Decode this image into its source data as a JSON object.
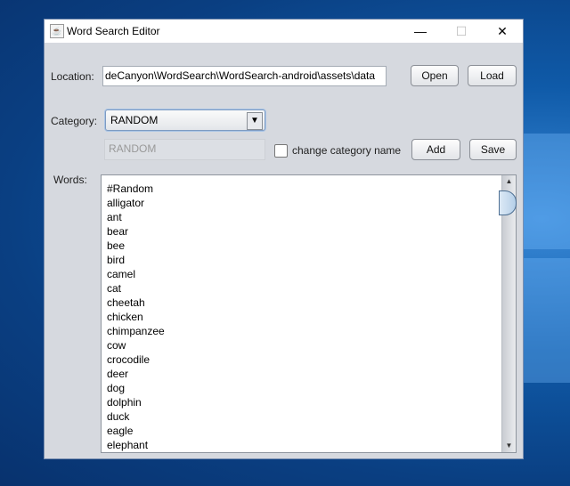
{
  "window": {
    "title": "Word Search Editor",
    "minimize": "—",
    "maximize": "☐",
    "close": "✕"
  },
  "location": {
    "label": "Location:",
    "value": "deCanyon\\WordSearch\\WordSearch-android\\assets\\data",
    "open": "Open",
    "load": "Load"
  },
  "category": {
    "label": "Category:",
    "selected": "RANDOM",
    "name_value": "RANDOM",
    "change_label": "change category name",
    "add": "Add",
    "save": "Save"
  },
  "words": {
    "label": "Words:",
    "items": [
      "#Random",
      "alligator",
      "ant",
      "bear",
      "bee",
      "bird",
      "camel",
      "cat",
      "cheetah",
      "chicken",
      "chimpanzee",
      "cow",
      "crocodile",
      "deer",
      "dog",
      "dolphin",
      "duck",
      "eagle",
      "elephant"
    ]
  }
}
